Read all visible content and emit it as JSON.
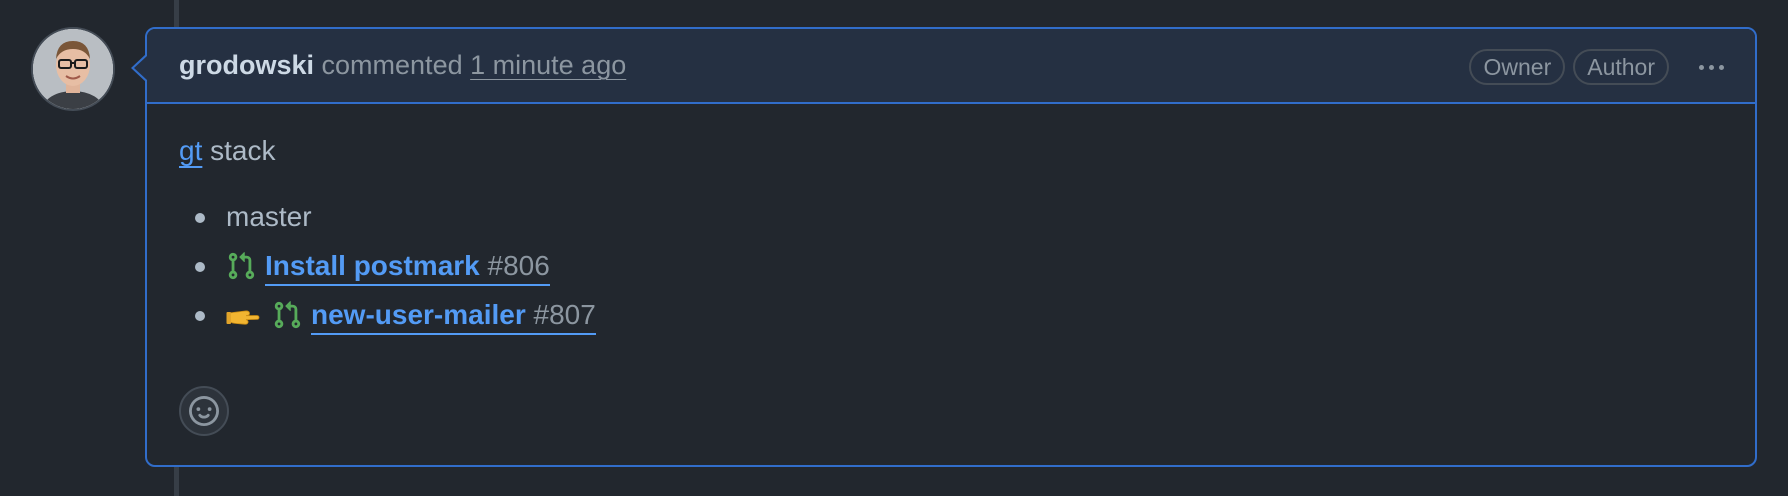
{
  "comment": {
    "author": "grodowski",
    "action": "commented",
    "timestamp": "1 minute ago",
    "badges": [
      "Owner",
      "Author"
    ],
    "avatar_icon": "user-avatar"
  },
  "body": {
    "tool_link": "gt",
    "title_suffix": "stack",
    "stack": [
      {
        "type": "branch",
        "label": "master"
      },
      {
        "type": "pr",
        "title": "Install postmark",
        "number": "#806",
        "icon": "git-pull-request-icon"
      },
      {
        "type": "pr",
        "title": "new-user-mailer",
        "number": "#807",
        "icon": "git-pull-request-icon",
        "current": true,
        "marker": "👉"
      }
    ]
  },
  "colors": {
    "accent": "#316dca",
    "link": "#539bf5",
    "pr_open": "#57ab5a",
    "background": "#22272e",
    "header_bg": "#253042"
  },
  "icons": {
    "more": "kebab-horizontal-icon",
    "reaction": "smiley-icon"
  }
}
